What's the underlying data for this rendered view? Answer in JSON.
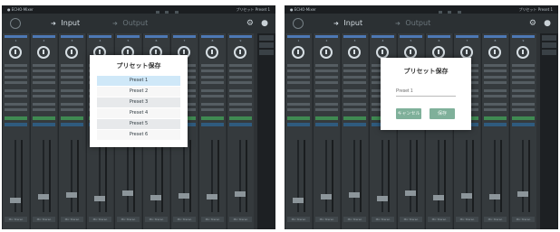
{
  "left": {
    "app": "● ECHO-Mixer",
    "preset_status": "プリセット  Preset 1",
    "tabs": {
      "input": "Input",
      "output": "Output"
    },
    "modal_title": "プリセット保存",
    "presets": [
      "Preset 1",
      "Preset 2",
      "Preset 3",
      "Preset 4",
      "Preset 5",
      "Preset 6"
    ],
    "selected_preset": "Preset 1"
  },
  "right": {
    "app": "● ECHO-Mixer",
    "preset_status": "プリセット  Preset 1",
    "tabs": {
      "input": "Input",
      "output": "Output"
    },
    "modal_title": "プリセット保存",
    "name_value": "Preset 1",
    "cancel_label": "キャンセル",
    "save_label": "保存"
  },
  "channels": [
    "1",
    "2",
    "3",
    "4",
    "5",
    "6",
    "7",
    "8",
    "9"
  ],
  "channel_name": "Mic Stereo",
  "fader_levels": [
    0.12,
    0.18,
    0.2,
    0.15,
    0.22,
    0.16,
    0.19,
    0.17,
    0.21
  ],
  "colors": {
    "background": "#24282b",
    "panel": "#353a3d",
    "accent_blue": "#4d78b5",
    "accent_green": "#3f8a52",
    "button_green": "#7fb09a",
    "selection": "#cfe8f8"
  },
  "icons": {
    "gear": "gear-icon",
    "user": "user-icon",
    "nav": "circle-icon"
  }
}
